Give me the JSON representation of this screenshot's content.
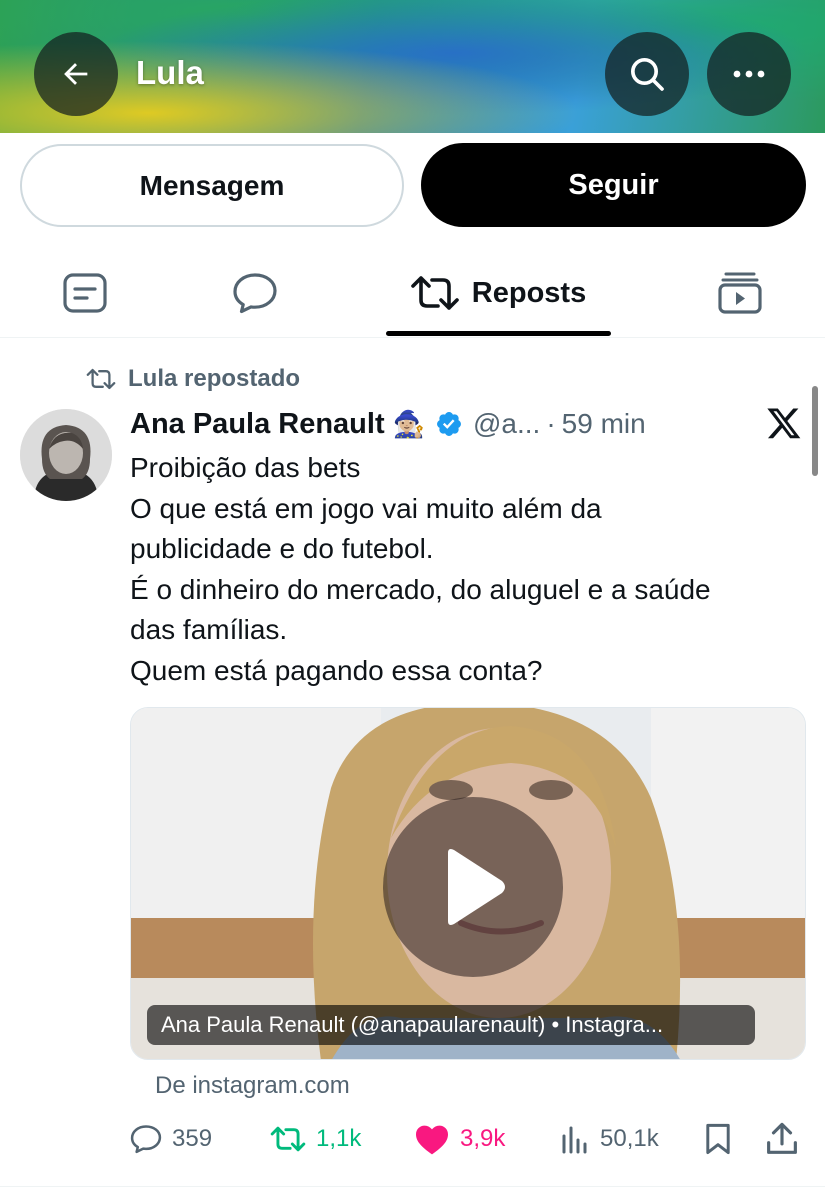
{
  "header": {
    "title": "Lula",
    "back_icon": "arrow-left-icon",
    "search_icon": "search-icon",
    "more_icon": "more-horizontal-icon"
  },
  "actions": {
    "message_label": "Mensagem",
    "follow_label": "Seguir"
  },
  "tabs": [
    {
      "icon": "posts-icon",
      "label": ""
    },
    {
      "icon": "replies-icon",
      "label": ""
    },
    {
      "icon": "repost-icon",
      "label": "Reposts",
      "selected": true
    },
    {
      "icon": "video-icon",
      "label": ""
    }
  ],
  "tweet": {
    "repost_label": "Lula repostado",
    "author_name": "Ana Paula Renault",
    "author_emoji": "🧙🏼‍♀️",
    "verified": true,
    "handle": "@a...",
    "time": "59 min",
    "text_lines": [
      "Proibição das bets",
      "O que está em jogo vai muito além da",
      "publicidade e do futebol.",
      "É o dinheiro do mercado, do aluguel e a saúde",
      "das famílias.",
      "Quem está pagando essa conta?"
    ],
    "media_caption": "Ana Paula Renault (@anapaularenault) • Instagra...",
    "source": "De instagram.com",
    "stats": {
      "replies": "359",
      "reposts": "1,1k",
      "likes": "3,9k",
      "views": "50,1k"
    }
  },
  "colors": {
    "repost_green": "#00ba7c",
    "like_pink": "#f91880",
    "verified_blue": "#1d9bf0",
    "muted": "#536471"
  }
}
